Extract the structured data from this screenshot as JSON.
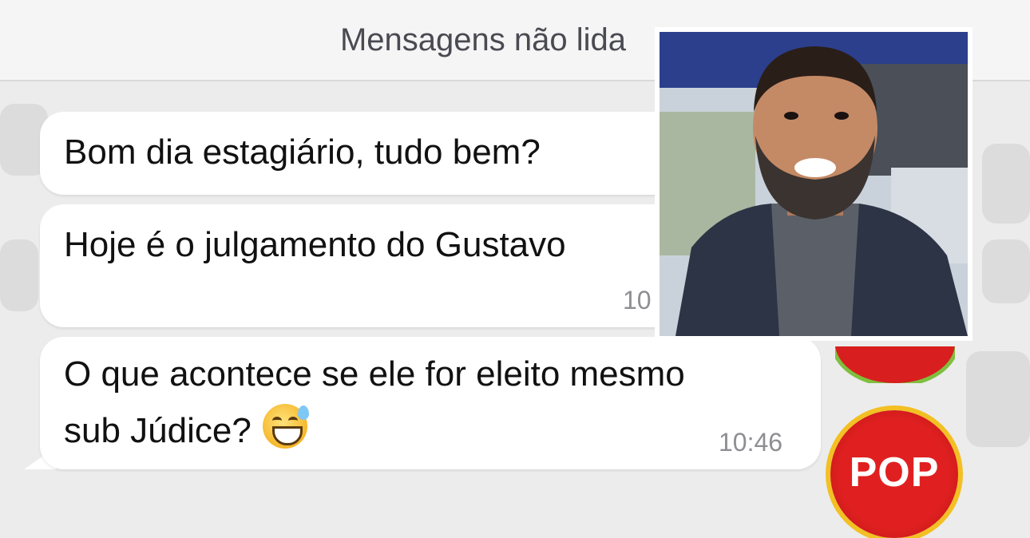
{
  "header": {
    "unread_label": "Mensagens não lida"
  },
  "messages": [
    {
      "text": "Bom dia estagiário, tudo bem?",
      "time": ""
    },
    {
      "text": "Hoje é o julgamento do Gustavo",
      "time": "10"
    },
    {
      "lines": [
        "O que acontece se ele for eleito mesmo",
        "sub Júdice?"
      ],
      "emoji": "sweat-smile-emoji",
      "time": "10:46"
    }
  ],
  "sticker": {
    "label": "POP"
  },
  "colors": {
    "bubble": "#ffffff",
    "background": "#ececec",
    "time": "#8e8e93"
  }
}
